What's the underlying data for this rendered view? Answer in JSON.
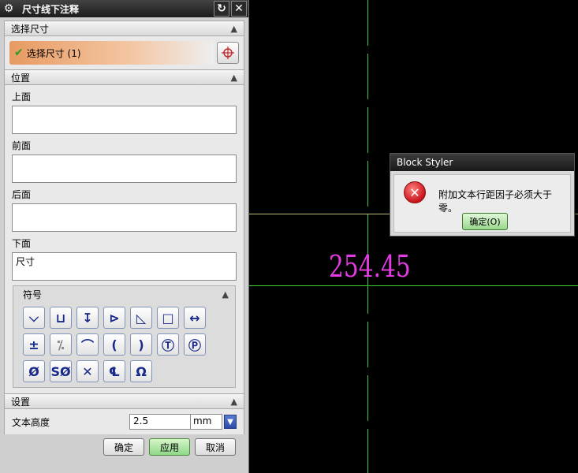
{
  "canvas": {
    "dimension_value": "254.45"
  },
  "dialog": {
    "title": "尺寸线下注释",
    "sections": {
      "select_dimension": {
        "header": "选择尺寸",
        "selected_label": "选择尺寸 (1)"
      },
      "position": {
        "header": "位置",
        "above_label": "上面",
        "above_value": "",
        "before_label": "前面",
        "before_value": "",
        "after_label": "后面",
        "after_value": "",
        "below_label": "下面",
        "below_value": "尺寸"
      },
      "symbols": {
        "header": "符号",
        "items": [
          "⌵",
          "⊔",
          "↧",
          "⊳",
          "◺",
          "□",
          "↔",
          "±",
          "⁒",
          "⌒",
          "(",
          ")",
          "Ⓣ",
          "Ⓟ",
          "Ø",
          "SØ",
          "✕",
          "℄",
          "Ω"
        ]
      },
      "settings": {
        "header": "设置",
        "text_height_label": "文本高度",
        "text_height_value": "2.5",
        "unit": "mm"
      }
    },
    "buttons": {
      "ok": "确定",
      "apply": "应用",
      "cancel": "取消"
    }
  },
  "alert": {
    "title": "Block Styler",
    "message": "附加文本行距因子必须大于零。",
    "ok_label": "确定(O)"
  }
}
